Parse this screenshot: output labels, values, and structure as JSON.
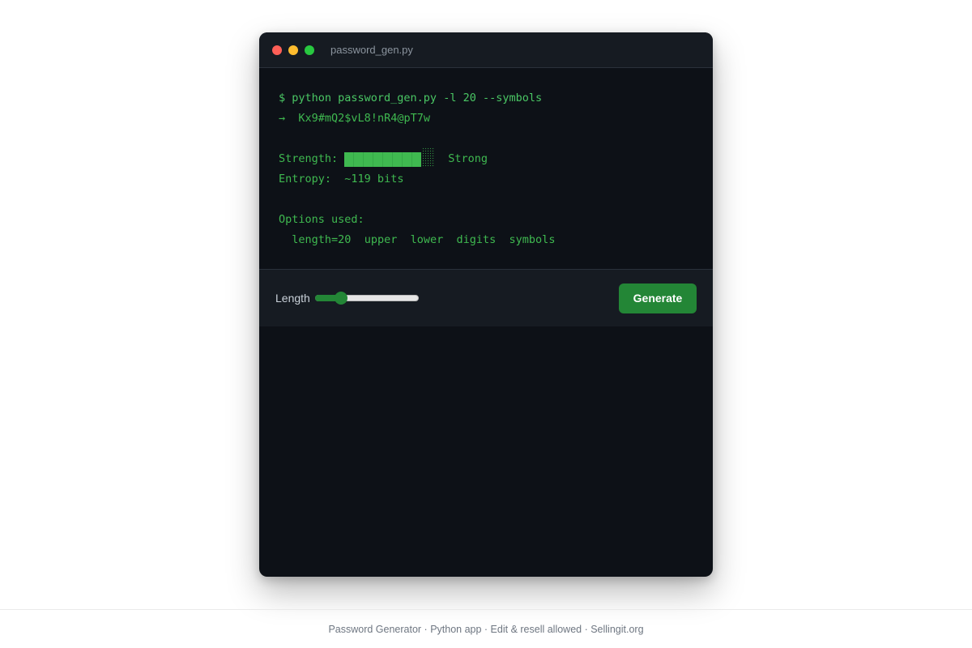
{
  "window": {
    "title": "password_gen.py"
  },
  "terminal": {
    "command": "$ python password_gen.py -l 20 --symbols",
    "arrow": "→",
    "password": "Kx9#mQ2$vL8!nR4@pT7w",
    "strength_label": "Strength:",
    "strength_fraction": 0.85,
    "strength_text": "Strong",
    "entropy_label": "Entropy:",
    "entropy_value": "~119 bits",
    "options_heading": "Options used:",
    "options": [
      "length=20",
      "upper",
      "lower",
      "digits",
      "symbols"
    ]
  },
  "controls": {
    "length_label": "Length",
    "slider_fraction": 0.25,
    "generate_label": "Generate"
  },
  "footer": {
    "text": "Password Generator · Python app · Edit & resell allowed · Sellingit.org"
  },
  "colors": {
    "terminal_bg": "#0d1117",
    "terminal_text": "#3fb950",
    "accent": "#238636"
  }
}
